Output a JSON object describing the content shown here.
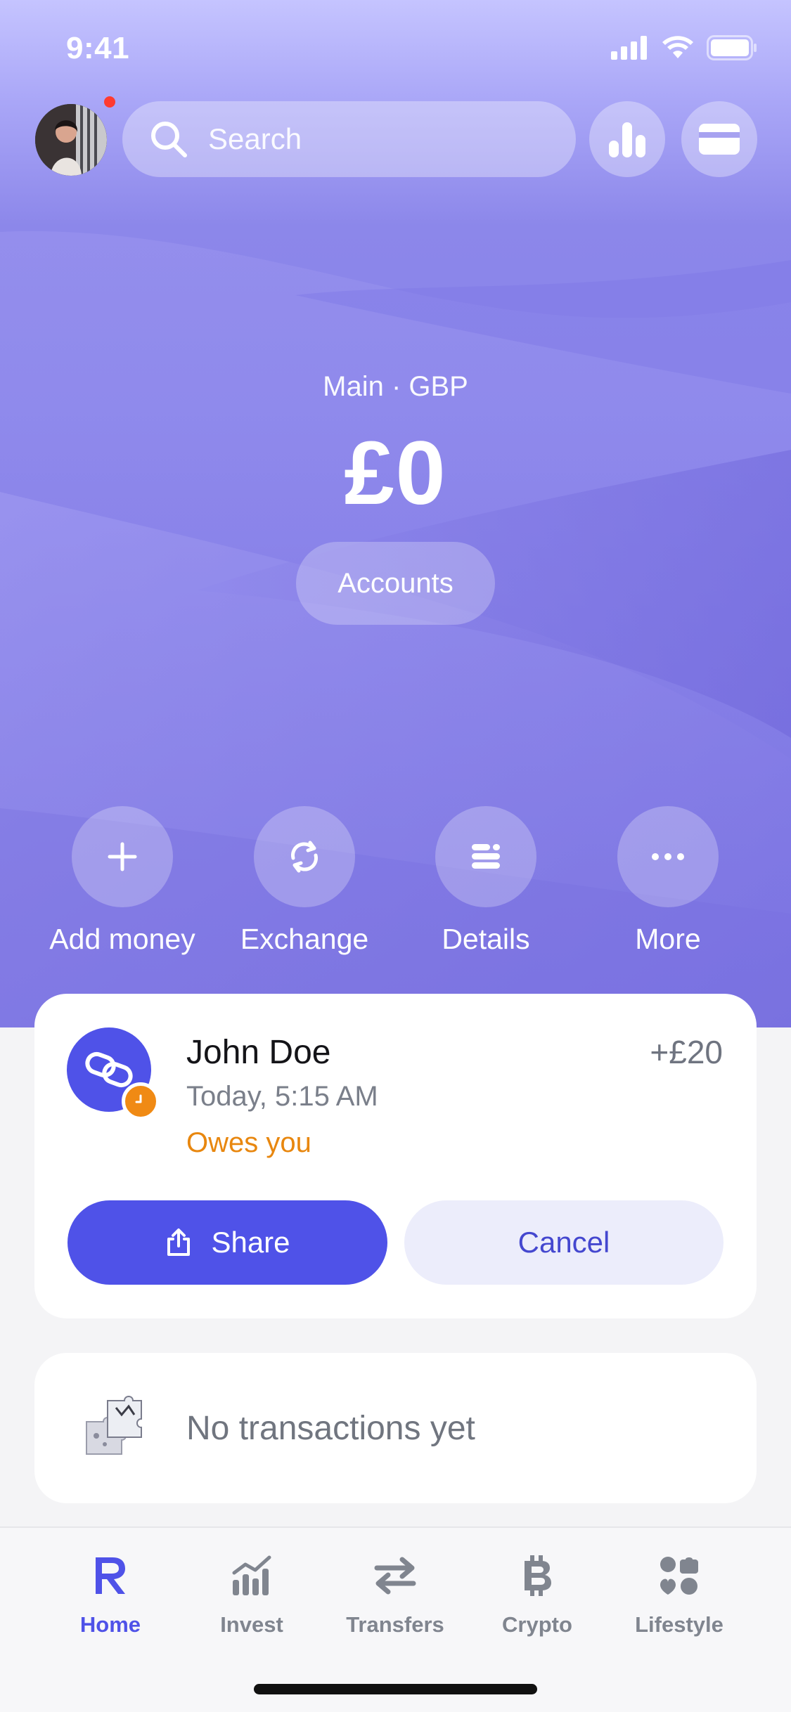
{
  "status_bar": {
    "time": "9:41"
  },
  "header": {
    "search_placeholder": "Search"
  },
  "account": {
    "label": "Main · GBP",
    "balance": "£0",
    "accounts_button": "Accounts"
  },
  "actions": [
    {
      "label": "Add money",
      "icon": "plus-icon"
    },
    {
      "label": "Exchange",
      "icon": "exchange-icon"
    },
    {
      "label": "Details",
      "icon": "details-icon"
    },
    {
      "label": "More",
      "icon": "more-icon"
    }
  ],
  "request": {
    "name": "John Doe",
    "time": "Today, 5:15 AM",
    "status": "Owes you",
    "amount": "+£20",
    "share_label": "Share",
    "cancel_label": "Cancel"
  },
  "transactions": {
    "empty_text": "No transactions yet"
  },
  "tabs": [
    {
      "label": "Home",
      "icon": "revolut-r-icon",
      "active": true
    },
    {
      "label": "Invest",
      "icon": "invest-chart-icon",
      "active": false
    },
    {
      "label": "Transfers",
      "icon": "transfers-arrows-icon",
      "active": false
    },
    {
      "label": "Crypto",
      "icon": "bitcoin-icon",
      "active": false
    },
    {
      "label": "Lifestyle",
      "icon": "lifestyle-icon",
      "active": false
    }
  ],
  "colors": {
    "accent": "#4f52e8",
    "warning": "#e8870f",
    "notification": "#ff3b30",
    "hero_top": "#c5c4ff",
    "hero_bottom": "#6d64d6"
  }
}
